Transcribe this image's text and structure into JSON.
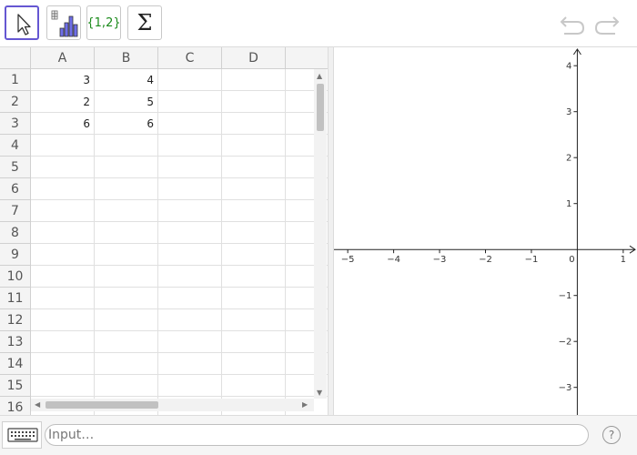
{
  "toolbar": {
    "tools": [
      {
        "name": "move-tool",
        "icon": "cursor-arrow-icon",
        "selected": true
      },
      {
        "name": "one-variable-analysis-tool",
        "icon": "bar-chart-icon"
      },
      {
        "name": "create-list-tool",
        "icon": "list-set-icon",
        "label": "{1,2}"
      },
      {
        "name": "sum-tool",
        "icon": "sigma-icon",
        "label": "Σ"
      }
    ],
    "undo_icon": "undo-icon",
    "redo_icon": "redo-icon"
  },
  "spreadsheet": {
    "columns": [
      "A",
      "B",
      "C",
      "D"
    ],
    "rows": [
      {
        "n": "1",
        "cells": [
          "3",
          "4",
          "",
          ""
        ]
      },
      {
        "n": "2",
        "cells": [
          "2",
          "5",
          "",
          ""
        ]
      },
      {
        "n": "3",
        "cells": [
          "6",
          "6",
          "",
          ""
        ]
      },
      {
        "n": "4",
        "cells": [
          "",
          "",
          "",
          ""
        ]
      },
      {
        "n": "5",
        "cells": [
          "",
          "",
          "",
          ""
        ]
      },
      {
        "n": "6",
        "cells": [
          "",
          "",
          "",
          ""
        ]
      },
      {
        "n": "7",
        "cells": [
          "",
          "",
          "",
          ""
        ]
      },
      {
        "n": "8",
        "cells": [
          "",
          "",
          "",
          ""
        ]
      },
      {
        "n": "9",
        "cells": [
          "",
          "",
          "",
          ""
        ]
      },
      {
        "n": "10",
        "cells": [
          "",
          "",
          "",
          ""
        ]
      },
      {
        "n": "11",
        "cells": [
          "",
          "",
          "",
          ""
        ]
      },
      {
        "n": "12",
        "cells": [
          "",
          "",
          "",
          ""
        ]
      },
      {
        "n": "13",
        "cells": [
          "",
          "",
          "",
          ""
        ]
      },
      {
        "n": "14",
        "cells": [
          "",
          "",
          "",
          ""
        ]
      },
      {
        "n": "15",
        "cells": [
          "",
          "",
          "",
          ""
        ]
      },
      {
        "n": "16",
        "cells": [
          "",
          "",
          "",
          ""
        ]
      }
    ]
  },
  "graphics": {
    "x_ticks": [
      "−5",
      "−4",
      "−3",
      "−2",
      "−1",
      "0",
      "1"
    ],
    "x_tick_values": [
      -5,
      -4,
      -3,
      -2,
      -1,
      0,
      1
    ],
    "y_ticks": [
      "4",
      "3",
      "2",
      "1",
      "−1",
      "−2",
      "−3"
    ],
    "y_tick_values": [
      4,
      3,
      2,
      1,
      -1,
      -2,
      -3
    ],
    "x_range": [
      -5.3,
      1.3
    ],
    "y_range": [
      -3.6,
      4.4
    ]
  },
  "input_bar": {
    "placeholder": "Input…",
    "keyboard_icon": "keyboard-icon",
    "help_label": "?"
  }
}
